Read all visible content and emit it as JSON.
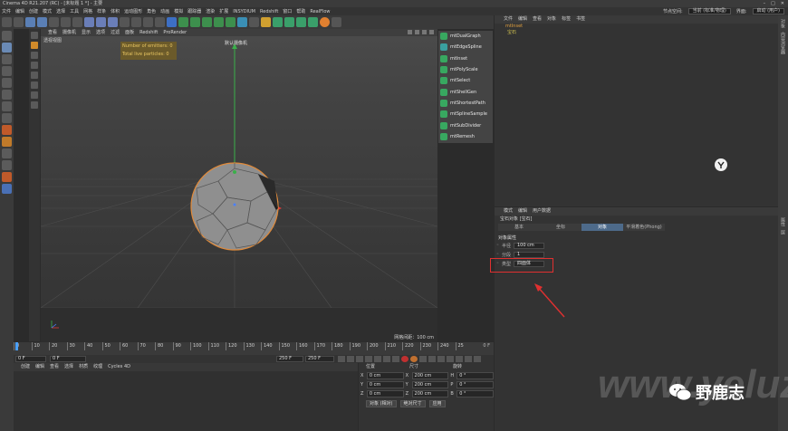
{
  "window": {
    "title": "Cinema 4D R21.207 (RC) - [未标题 1 *] - 主要"
  },
  "menubar": {
    "items": [
      "文件",
      "编辑",
      "创建",
      "模式",
      "选择",
      "工具",
      "网格",
      "样条",
      "体积",
      "运动图形",
      "角色",
      "动画",
      "模拟",
      "跟踪器",
      "渲染",
      "扩展",
      "INSYDIUM",
      "Redshift",
      "窗口",
      "帮助",
      "RealFlow"
    ],
    "layout_label": "界面:",
    "layout_value": "启动 (用户)",
    "node_label": "节点空间:",
    "node_value": "当前 (标准/物理)"
  },
  "viewport": {
    "menu": [
      "查看",
      "摄像机",
      "显示",
      "选项",
      "过滤",
      "面板",
      "Redshift",
      "ProRender"
    ],
    "view_label": "透视视图",
    "camera_label": "默认摄像机",
    "hud": [
      "Number of emitters: 0",
      "Total live particles: 0"
    ],
    "grid_info": "网格间距：100 cm"
  },
  "plugin_menu": {
    "items": [
      {
        "label": "mtDualGraph",
        "color": "#38a860"
      },
      {
        "label": "mtEdgeSpline",
        "color": "#3aa0a0"
      },
      {
        "label": "mtInset",
        "color": "#38a860"
      },
      {
        "label": "mtPolyScale",
        "color": "#38a860"
      },
      {
        "label": "mtSelect",
        "color": "#38a860"
      },
      {
        "label": "mtShellGen",
        "color": "#38a860"
      },
      {
        "label": "mtShortestPath",
        "color": "#38a860"
      },
      {
        "label": "mtSplineSample",
        "color": "#38a860"
      },
      {
        "label": "mtSubDivider",
        "color": "#38a860"
      },
      {
        "label": "mtRemesh",
        "color": "#38a860"
      }
    ]
  },
  "object_manager": {
    "menu": [
      "文件",
      "编辑",
      "查看",
      "对象",
      "标签",
      "书签"
    ],
    "objects": [
      "mtInset",
      "宝石"
    ]
  },
  "attribute_manager": {
    "menu": [
      "模式",
      "编辑",
      "用户数据"
    ],
    "title": "宝石对象 [宝石]",
    "tabs": [
      "基本",
      "坐标",
      "对象",
      "平滑着色(Phong)"
    ],
    "section": "对象属性",
    "fields": [
      {
        "label": "半径",
        "value": "100 cm"
      },
      {
        "label": "分段",
        "value": "1"
      },
      {
        "label": "类型",
        "value": "四面体"
      }
    ]
  },
  "timeline": {
    "ticks": [
      "0",
      "10",
      "20",
      "30",
      "40",
      "50",
      "60",
      "70",
      "80",
      "90",
      "100",
      "110",
      "120",
      "130",
      "140",
      "150",
      "160",
      "170",
      "180",
      "190",
      "200",
      "210",
      "220",
      "230",
      "240",
      "25"
    ],
    "current_frame": "0 F",
    "start": "0 F",
    "start2": "0 F",
    "end": "250 F",
    "end2": "250 F"
  },
  "material_manager": {
    "menu": [
      "创建",
      "编辑",
      "查看",
      "选择",
      "材质",
      "纹理",
      "Cycles 4D"
    ]
  },
  "coordinates": {
    "headers": [
      "位置",
      "尺寸",
      "旋转"
    ],
    "rows": [
      {
        "axis": "X",
        "pos": "0 cm",
        "size_axis": "X",
        "size": "200 cm",
        "rot_axis": "H",
        "rot": "0 °"
      },
      {
        "axis": "Y",
        "pos": "0 cm",
        "size_axis": "Y",
        "size": "200 cm",
        "rot_axis": "P",
        "rot": "0 °"
      },
      {
        "axis": "Z",
        "pos": "0 cm",
        "size_axis": "Z",
        "size": "200 cm",
        "rot_axis": "B",
        "rot": "0 °"
      }
    ],
    "mode": "对象 (相对)",
    "size_mode": "绝对尺寸",
    "apply": "应用"
  },
  "watermark": {
    "text": "野鹿志",
    "url": "www.yeluzhi.com"
  }
}
